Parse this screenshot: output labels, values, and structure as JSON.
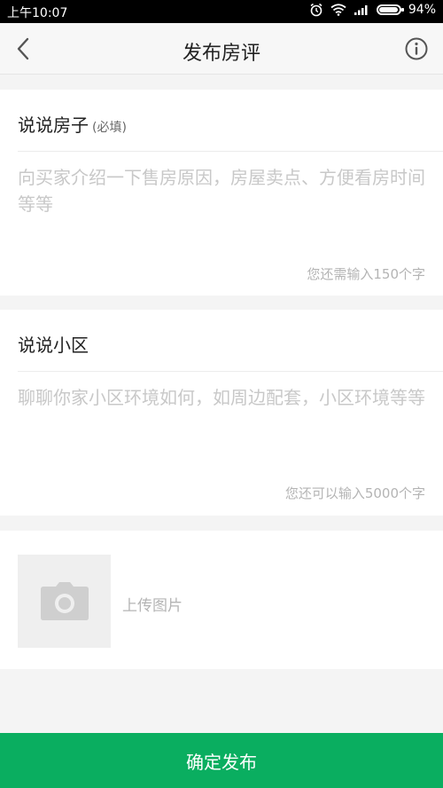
{
  "status_bar": {
    "time": "上午10:07",
    "battery": "94%",
    "battery_level": 0.94
  },
  "header": {
    "title": "发布房评",
    "back_icon": "chevron-left-icon",
    "info_icon": "info-circle-icon"
  },
  "house_section": {
    "title": "说说房子",
    "required_tag": "(必填)",
    "placeholder": "向买家介绍一下售房原因，房屋卖点、方便看房时间等等",
    "counter": "您还需输入150个字"
  },
  "community_section": {
    "title": "说说小区",
    "placeholder": "聊聊你家小区环境如何，如周边配套，小区环境等等",
    "counter": "您还可以输入5000个字"
  },
  "upload": {
    "label": "上传图片",
    "icon": "camera-icon"
  },
  "submit": {
    "label": "确定发布"
  },
  "colors": {
    "primary": "#0aae60",
    "background": "#f4f4f4",
    "placeholder": "#c8c8c8"
  }
}
